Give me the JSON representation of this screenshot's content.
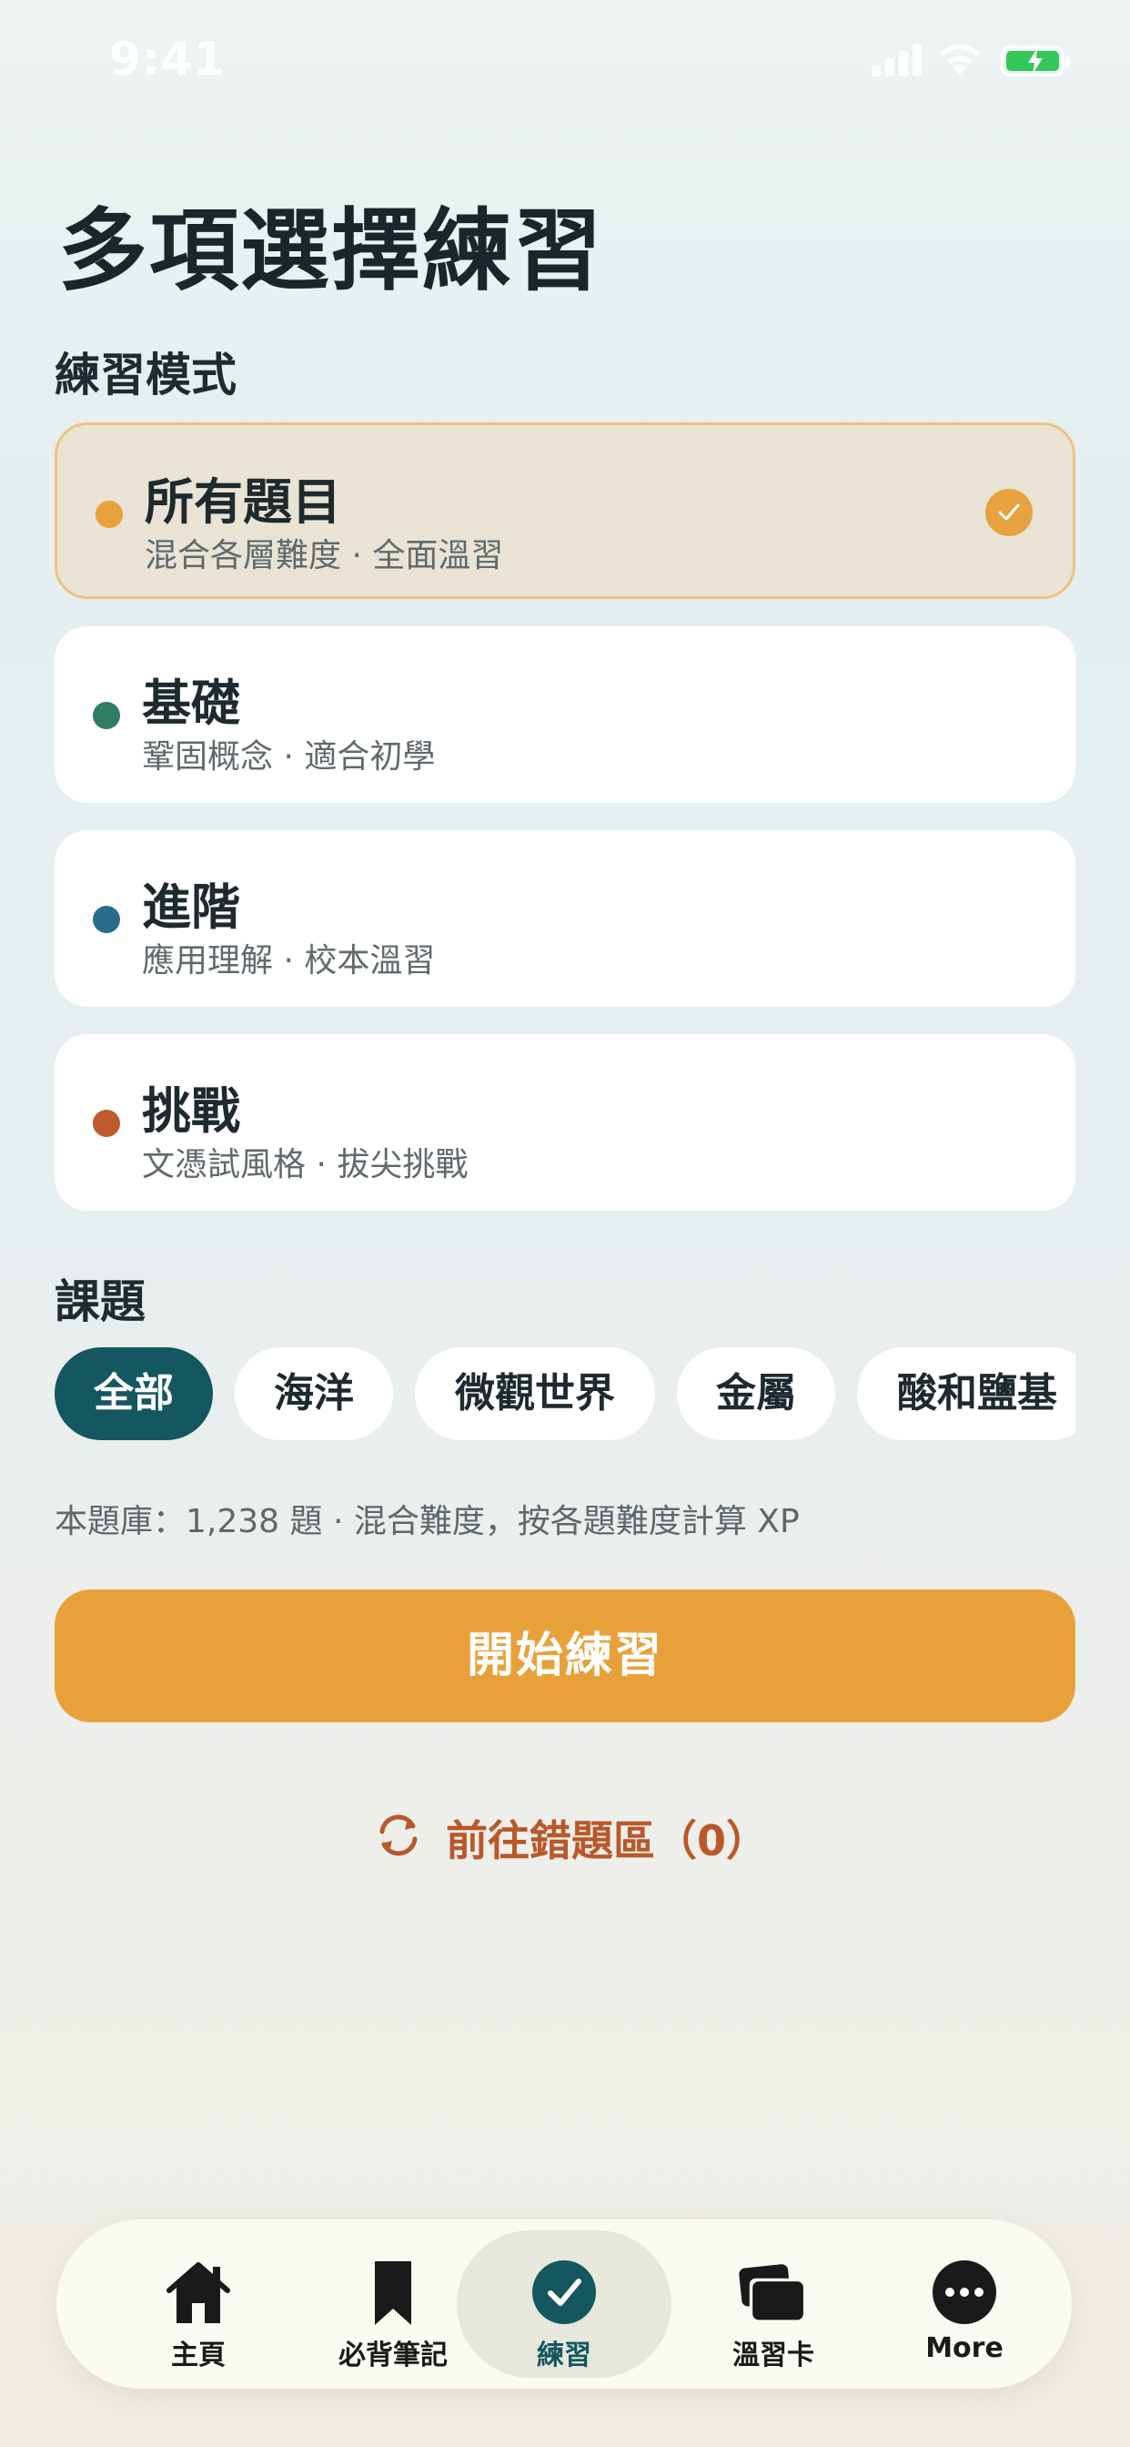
{
  "status_bar": {
    "time": "9:41"
  },
  "page_title": "多項選擇練習",
  "mode_section": {
    "label": "練習模式",
    "modes": [
      {
        "title": "所有題目",
        "subtitle": "混合各層難度 · 全面溫習",
        "dot_color": "#e8a13a",
        "selected": true
      },
      {
        "title": "基礎",
        "subtitle": "鞏固概念 · 適合初學",
        "dot_color": "#2f7d62",
        "selected": false
      },
      {
        "title": "進階",
        "subtitle": "應用理解 · 校本溫習",
        "dot_color": "#2a6c8c",
        "selected": false
      },
      {
        "title": "挑戰",
        "subtitle": "文憑試風格 · 拔尖挑戰",
        "dot_color": "#bf5b2e",
        "selected": false
      }
    ]
  },
  "topic_section": {
    "label": "課題",
    "chips": [
      "全部",
      "海洋",
      "微觀世界",
      "金屬",
      "酸和鹽基"
    ]
  },
  "info_text": "本題庫：1,238 題 · 混合難度，按各題難度計算 XP",
  "start_button": "開始練習",
  "mistakes_link": "前往錯題區（0）",
  "tab_bar": {
    "tabs": [
      {
        "label": "主頁",
        "icon": "home-icon"
      },
      {
        "label": "必背筆記",
        "icon": "bookmark-icon"
      },
      {
        "label": "練習",
        "icon": "check-circle-icon",
        "active": true
      },
      {
        "label": "溫習卡",
        "icon": "cards-icon"
      },
      {
        "label": "More",
        "icon": "more-icon"
      }
    ]
  },
  "colors": {
    "accent": "#e8a13a",
    "primary": "#155760",
    "link": "#b9582a"
  }
}
